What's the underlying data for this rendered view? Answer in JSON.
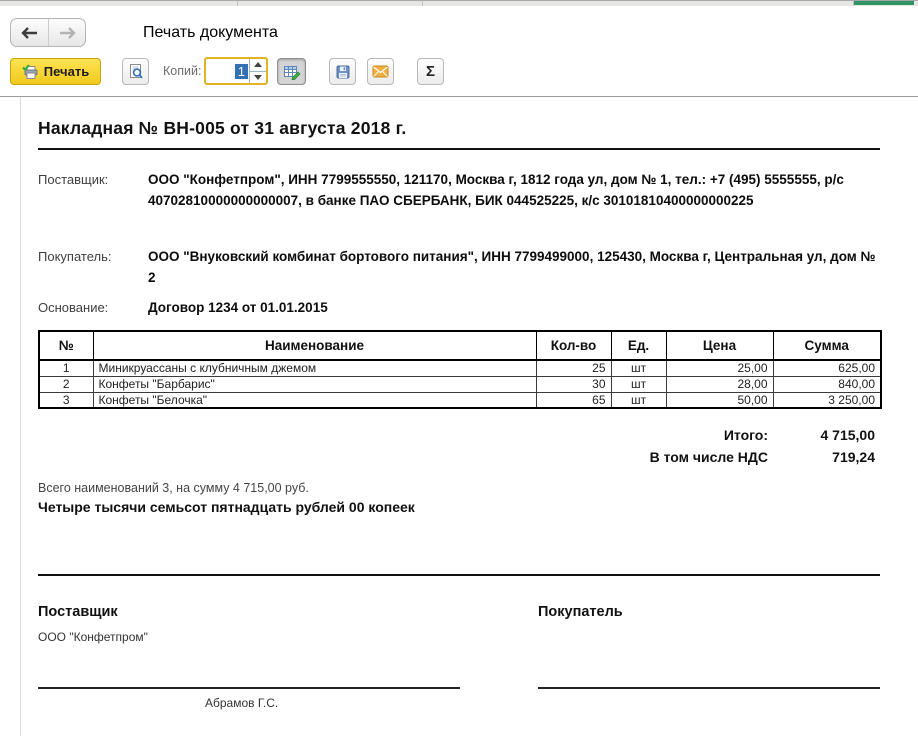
{
  "window": {
    "title": "Печать документа",
    "accent_tab_color": "#2e9464"
  },
  "toolbar": {
    "print_label": "Печать",
    "copies_label": "Копий:",
    "copies_value": "1",
    "sigma_glyph": "Σ",
    "icons": {
      "back": "arrow-left-icon",
      "forward": "arrow-right-icon",
      "print": "printer-check-icon",
      "preview": "document-magnifier-icon",
      "edit": "table-pencil-icon",
      "save": "floppy-disk-icon",
      "email": "envelope-icon",
      "sum": "sigma-icon"
    },
    "print_button_color": "#f2cd1f"
  },
  "doc": {
    "title": "Накладная № ВН-005 от 31 августа 2018 г.",
    "fields": [
      {
        "label": "Поставщик:",
        "value": "ООО \"Конфетпром\", ИНН 7799555550, 121170, Москва г, 1812 года ул, дом № 1, тел.: +7 (495) 5555555, р/с 40702810000000000007, в банке ПАО СБЕРБАНК, БИК 044525225, к/с 30101810400000000225"
      },
      {
        "label": "Покупатель:",
        "value": "ООО \"Внуковский комбинат бортового питания\", ИНН 7799499000, 125430, Москва г, Центральная ул, дом № 2"
      },
      {
        "label": "Основание:",
        "value": "Договор 1234 от 01.01.2015"
      }
    ],
    "table": {
      "headers": [
        "№",
        "Наименование",
        "Кол-во",
        "Ед.",
        "Цена",
        "Сумма"
      ],
      "rows": [
        {
          "num": "1",
          "name": "Миникруассаны с клубничным джемом",
          "qty": "25",
          "unit": "шт",
          "price": "25,00",
          "sum": "625,00"
        },
        {
          "num": "2",
          "name": "Конфеты \"Барбарис\"",
          "qty": "30",
          "unit": "шт",
          "price": "28,00",
          "sum": "840,00"
        },
        {
          "num": "3",
          "name": "Конфеты \"Белочка\"",
          "qty": "65",
          "unit": "шт",
          "price": "50,00",
          "sum": "3 250,00"
        }
      ],
      "totals": [
        {
          "label": "Итого:",
          "value": "4 715,00"
        },
        {
          "label": "В том числе НДС",
          "value": "719,24"
        }
      ]
    },
    "summary_line1": "Всего наименований 3, на сумму 4 715,00 руб.",
    "summary_line2": "Четыре тысячи семьсот пятнадцать рублей 00 копеек",
    "signatures": {
      "supplier_title": "Поставщик",
      "supplier_org": "ООО \"Конфетпром\"",
      "supplier_signer": "Абрамов Г.С.",
      "buyer_title": "Покупатель"
    }
  }
}
